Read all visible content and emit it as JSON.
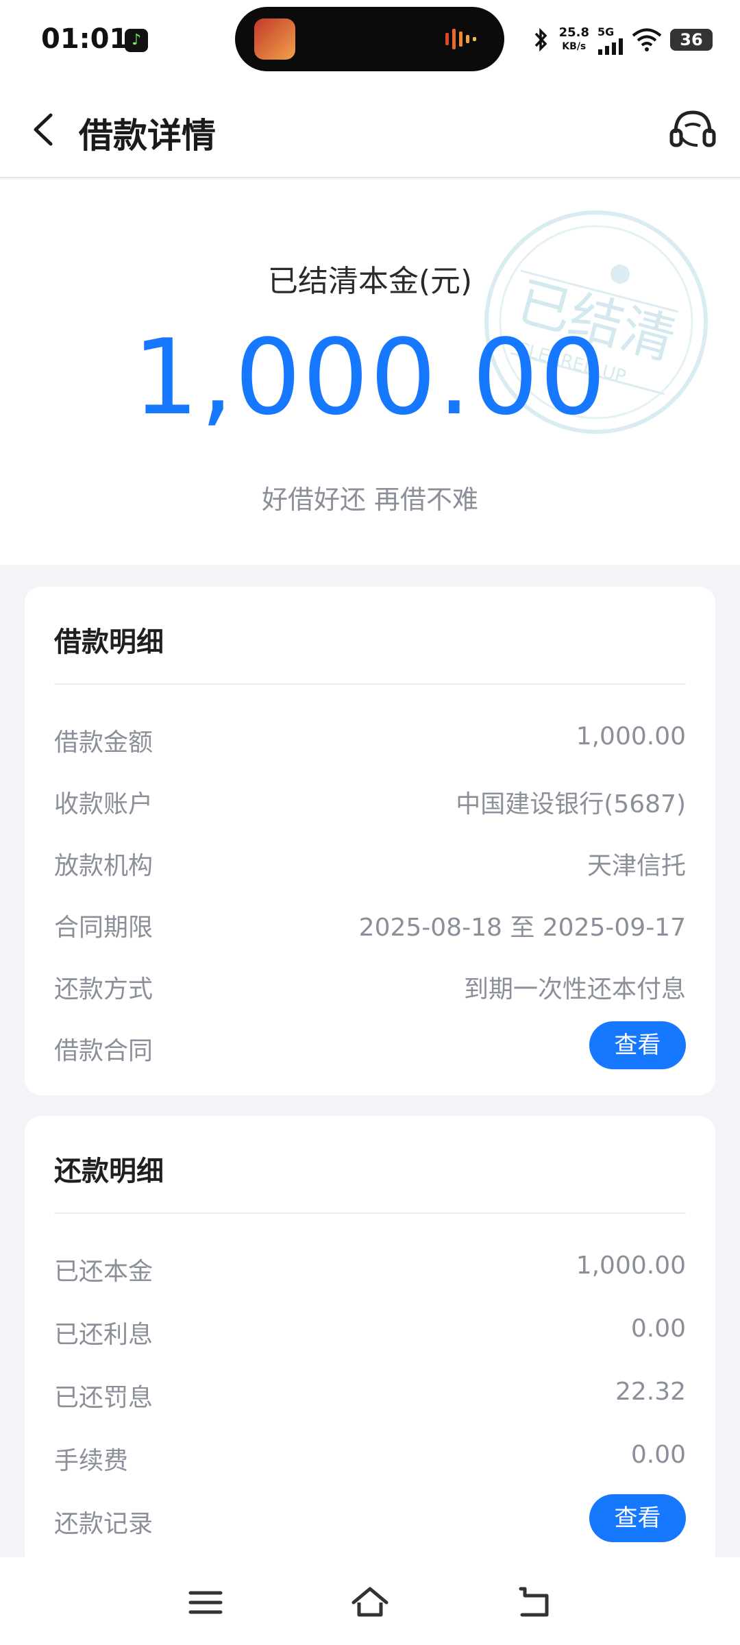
{
  "status_bar": {
    "time": "01:01",
    "net_speed_value": "25.8",
    "net_speed_unit": "KB/s",
    "network": "5G",
    "battery": "36"
  },
  "header": {
    "title": "借款详情",
    "back_icon": "chevron-left-icon",
    "support_icon": "headset-icon"
  },
  "hero": {
    "label": "已结清本金(元)",
    "amount": "1,000.00",
    "slogan": "好借好还 再借不难",
    "stamp_text": "已结清",
    "stamp_subtext": "CLEARED UP"
  },
  "loan_details": {
    "title": "借款明细",
    "rows": [
      {
        "label": "借款金额",
        "value": "1,000.00"
      },
      {
        "label": "收款账户",
        "value": "中国建设银行(5687)"
      },
      {
        "label": "放款机构",
        "value": "天津信托"
      },
      {
        "label": "合同期限",
        "value": "2025-08-18 至 2025-09-17"
      },
      {
        "label": "还款方式",
        "value": "到期一次性还本付息"
      },
      {
        "label": "借款合同",
        "button": "查看"
      }
    ]
  },
  "repay_details": {
    "title": "还款明细",
    "rows": [
      {
        "label": "已还本金",
        "value": "1,000.00"
      },
      {
        "label": "已还利息",
        "value": "0.00"
      },
      {
        "label": "已还罚息",
        "value": "22.32"
      },
      {
        "label": "手续费",
        "value": "0.00"
      },
      {
        "label": "还款记录",
        "button": "查看"
      }
    ]
  },
  "colors": {
    "accent": "#1677ff",
    "muted_text": "#8a8f99",
    "background": "#f2f4f8"
  },
  "system_nav": [
    "menu-icon",
    "home-icon",
    "back-icon"
  ]
}
